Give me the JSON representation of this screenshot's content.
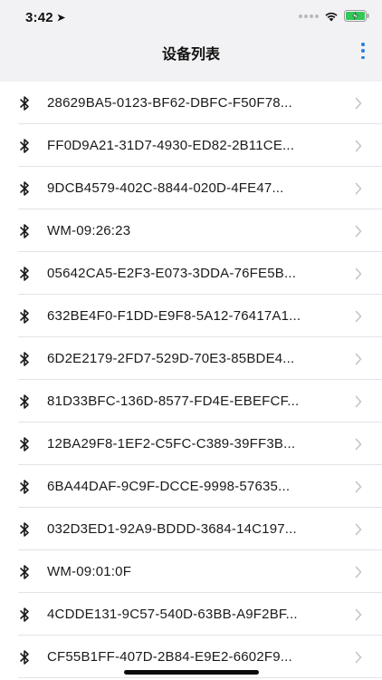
{
  "status": {
    "time": "3:42"
  },
  "nav": {
    "title": "设备列表"
  },
  "devices": [
    {
      "name": "28629BA5-0123-BF62-DBFC-F50F78..."
    },
    {
      "name": "FF0D9A21-31D7-4930-ED82-2B11CE..."
    },
    {
      "name": "9DCB4579-402C-8844-020D-4FE47..."
    },
    {
      "name": "WM-09:26:23"
    },
    {
      "name": "05642CA5-E2F3-E073-3DDA-76FE5B..."
    },
    {
      "name": "632BE4F0-F1DD-E9F8-5A12-76417A1..."
    },
    {
      "name": "6D2E2179-2FD7-529D-70E3-85BDE4..."
    },
    {
      "name": "81D33BFC-136D-8577-FD4E-EBEFCF..."
    },
    {
      "name": "12BA29F8-1EF2-C5FC-C389-39FF3B..."
    },
    {
      "name": "6BA44DAF-9C9F-DCCE-9998-57635..."
    },
    {
      "name": "032D3ED1-92A9-BDDD-3684-14C197..."
    },
    {
      "name": "WM-09:01:0F"
    },
    {
      "name": "4CDDE131-9C57-540D-63BB-A9F2BF..."
    },
    {
      "name": "CF55B1FF-407D-2B84-E9E2-6602F9..."
    }
  ],
  "icons": {
    "location": "location-arrow-icon",
    "signal": "cellular-signal-icon",
    "wifi": "wifi-icon",
    "battery": "battery-charging-icon",
    "more": "more-vertical-icon",
    "bluetooth": "bluetooth-icon",
    "chevron": "chevron-right-icon"
  },
  "colors": {
    "accent": "#2f7fd9",
    "battery": "#34c759"
  }
}
